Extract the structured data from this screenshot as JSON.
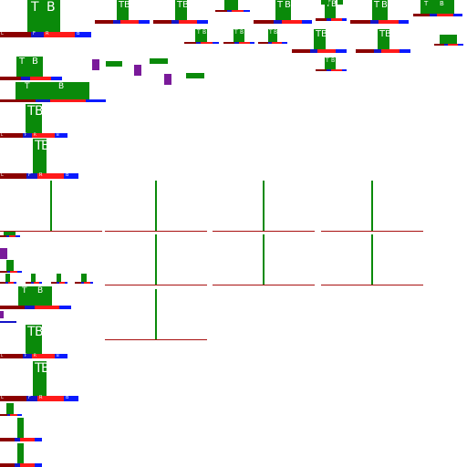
{
  "labels": {
    "top_left": "T",
    "top_right": "B",
    "bottom_left": "L",
    "bottom_mid_1": "F",
    "bottom_mid_2": "R",
    "bottom_right": "B"
  },
  "colors": {
    "green": "#0a8a0a",
    "dark_red": "#8b0000",
    "red": "#ff1a1a",
    "blue": "#0a1aff",
    "purple": "#7a1a9a",
    "background": "#ffffff"
  }
}
